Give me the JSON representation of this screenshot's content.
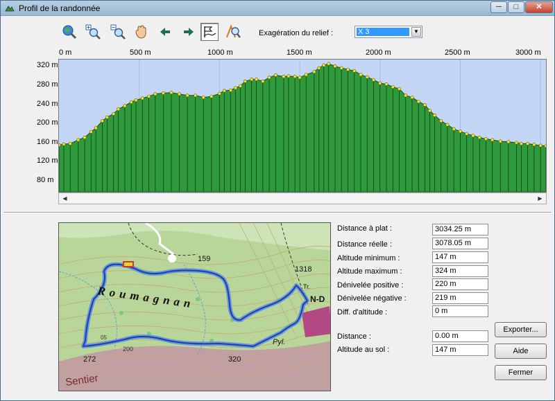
{
  "window": {
    "title": "Profil de la randonnée"
  },
  "titlebar_buttons": {
    "minimize": "─",
    "maximize": "□",
    "close": "✕"
  },
  "toolbar": {
    "tools": [
      {
        "name": "globe-zoom-tool",
        "icon": "globe-magnifier-icon"
      },
      {
        "name": "zoom-in-tool",
        "icon": "zoom-in-icon"
      },
      {
        "name": "zoom-out-tool",
        "icon": "zoom-out-icon"
      },
      {
        "name": "pan-tool",
        "icon": "hand-icon"
      },
      {
        "name": "back-tool",
        "icon": "arrow-left-icon"
      },
      {
        "name": "forward-tool",
        "icon": "arrow-right-icon"
      },
      {
        "name": "profile-tool",
        "icon": "flag-profile-icon",
        "active": true
      },
      {
        "name": "map-zoom-tool",
        "icon": "map-magnifier-icon"
      }
    ],
    "relief_label": "Exagération du relief :",
    "relief_value": "X 3"
  },
  "chart_data": {
    "type": "area",
    "x_ticks": [
      "0 m",
      "500 m",
      "1000 m",
      "1500 m",
      "2000 m",
      "2500 m",
      "3000 m"
    ],
    "y_ticks": [
      "320 m",
      "280 m",
      "240 m",
      "200 m",
      "160 m",
      "120 m",
      "80 m"
    ],
    "xlim": [
      0,
      3034
    ],
    "ylim": [
      50,
      330
    ],
    "xlabel": "",
    "ylabel": "",
    "fill_color": "#2f9a3c",
    "background_color": "#c4d6f6",
    "series": [
      {
        "x": [
          0,
          30,
          70,
          120,
          160,
          200,
          230,
          270,
          300,
          340,
          370,
          410,
          450,
          480,
          520,
          560,
          600,
          650,
          700,
          750,
          800,
          850,
          900,
          950,
          1000,
          1030,
          1070,
          1100,
          1130,
          1160,
          1200,
          1230,
          1270,
          1310,
          1350,
          1400,
          1430,
          1470,
          1500,
          1540,
          1590,
          1620,
          1650,
          1680,
          1720,
          1760,
          1800,
          1840,
          1880,
          1920,
          1960,
          2000,
          2040,
          2080,
          2120,
          2160,
          2200,
          2240,
          2280,
          2310,
          2340,
          2380,
          2420,
          2460,
          2500,
          2540,
          2580,
          2620,
          2660,
          2700,
          2750,
          2800,
          2850,
          2880,
          2920,
          2960,
          3000,
          3034
        ],
        "y": [
          149,
          151,
          152,
          160,
          165,
          177,
          185,
          200,
          208,
          215,
          225,
          232,
          240,
          244,
          248,
          252,
          257,
          259,
          260,
          257,
          254,
          254,
          250,
          252,
          258,
          264,
          265,
          270,
          274,
          284,
          288,
          288,
          284,
          292,
          297,
          294,
          295,
          294,
          292,
          298,
          304,
          312,
          318,
          321,
          316,
          312,
          309,
          306,
          298,
          293,
          287,
          280,
          278,
          272,
          268,
          254,
          250,
          241,
          234,
          222,
          212,
          200,
          192,
          183,
          178,
          173,
          169,
          165,
          162,
          160,
          157,
          156,
          154,
          152,
          152,
          150,
          148,
          147
        ]
      }
    ]
  },
  "stats": [
    {
      "label": "Distance à plat :",
      "value": "3034.25 m"
    },
    {
      "label": "Distance réelle :",
      "value": "3078.05 m"
    },
    {
      "label": "Altitude minimum :",
      "value": "147 m"
    },
    {
      "label": "Altitude maximum :",
      "value": "324 m"
    },
    {
      "label": "Dénivelée positive :",
      "value": "220 m"
    },
    {
      "label": "Dénivelée négative :",
      "value": "219 m"
    },
    {
      "label": "Diff. d'altitude :",
      "value": "0 m"
    }
  ],
  "cursor": {
    "distance_label": "Distance :",
    "distance_value": "0.00 m",
    "ground_label": "Altitude au sol :",
    "ground_value": "147 m"
  },
  "buttons": {
    "export": "Exporter...",
    "help": "Aide",
    "close": "Fermer"
  },
  "map": {
    "place_name": "Roumagnan",
    "elevations": [
      "159",
      "1318",
      "272",
      "320",
      "200"
    ],
    "labels": [
      "N-D",
      "Pyl.",
      "Sentier",
      "Tr.",
      "05"
    ]
  }
}
